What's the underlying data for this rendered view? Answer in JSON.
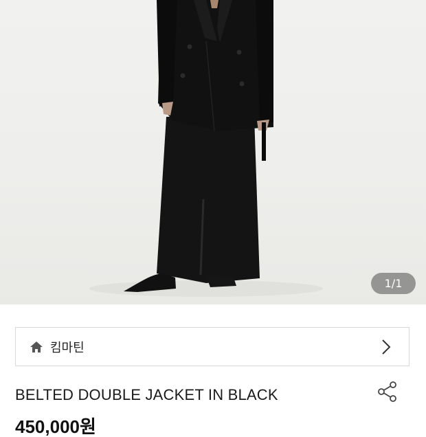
{
  "hero": {
    "image_alt_name": "product-photo",
    "counter": "1/1"
  },
  "brand": {
    "icon": "home-icon",
    "name": "킴마틴",
    "chevron_icon": "chevron-right-icon"
  },
  "product": {
    "title": "BELTED DOUBLE JACKET IN BLACK",
    "share_icon": "share-icon",
    "price": "450,000원"
  },
  "colors": {
    "hero_background": "#eeeeec",
    "counter_badge": "#7a7a7a",
    "border": "#d8d8d8",
    "text": "#222222"
  }
}
